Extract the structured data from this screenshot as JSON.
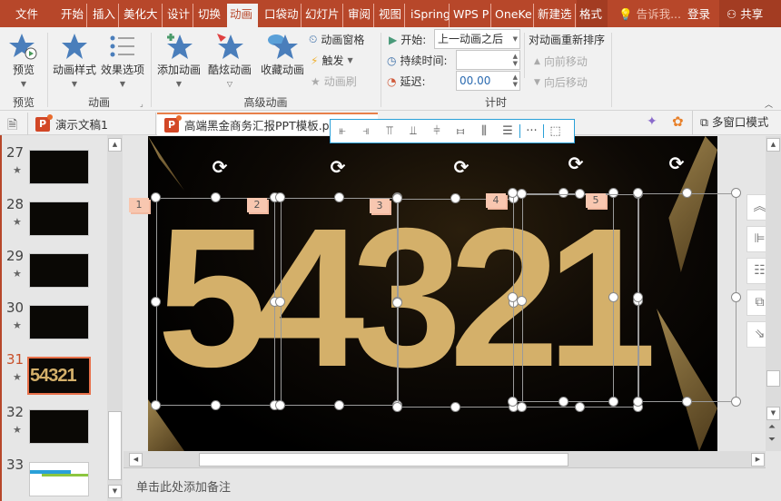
{
  "ribbon_tabs": [
    {
      "label": "文件"
    },
    {
      "label": "开始"
    },
    {
      "label": "插入"
    },
    {
      "label": "美化大"
    },
    {
      "label": "设计"
    },
    {
      "label": "切换"
    },
    {
      "label": "动画",
      "active": true
    },
    {
      "label": "口袋动"
    },
    {
      "label": "幻灯片"
    },
    {
      "label": "审阅"
    },
    {
      "label": "视图"
    },
    {
      "label": "iSpring"
    },
    {
      "label": "WPS P"
    },
    {
      "label": "OneKe"
    },
    {
      "label": "新建选"
    },
    {
      "label": "格式"
    }
  ],
  "tell_me": "告诉我...",
  "login": "登录",
  "share": "共享",
  "ribbon": {
    "preview": {
      "button": "预览",
      "group": "预览"
    },
    "animation": {
      "styles": "动画样式",
      "effects": "效果选项",
      "group": "动画"
    },
    "advanced": {
      "add": "添加动画",
      "cool": "酷炫动画",
      "fav": "收藏动画",
      "pane": "动画窗格",
      "trigger": "触发",
      "painter": "动画刷",
      "group": "高级动画"
    },
    "timing": {
      "start_label": "开始:",
      "start_value": "上一动画之后",
      "duration_label": "持续时间:",
      "duration_value": "",
      "delay_label": "延迟:",
      "delay_value": "00.00",
      "reorder": "对动画重新排序",
      "move_earlier": "向前移动",
      "move_later": "向后移动",
      "group": "计时"
    }
  },
  "doc_tabs": [
    {
      "label": "演示文稿1"
    },
    {
      "label": "高端黑金商务汇报PPT模板.pptx"
    }
  ],
  "multiwindow": "多窗口模式",
  "thumbnails": [
    {
      "num": "27"
    },
    {
      "num": "28"
    },
    {
      "num": "29"
    },
    {
      "num": "30"
    },
    {
      "num": "31",
      "selected": true
    },
    {
      "num": "32"
    },
    {
      "num": "33"
    }
  ],
  "thumb31_text": "54321",
  "slide": {
    "text": "54321",
    "anim_tags": [
      "1",
      "2",
      "3",
      "4",
      "5"
    ]
  },
  "notes_placeholder": "单击此处添加备注",
  "colors": {
    "accent": "#b7472a",
    "gold": "#d4b06a",
    "selection": "#29a0d8"
  }
}
